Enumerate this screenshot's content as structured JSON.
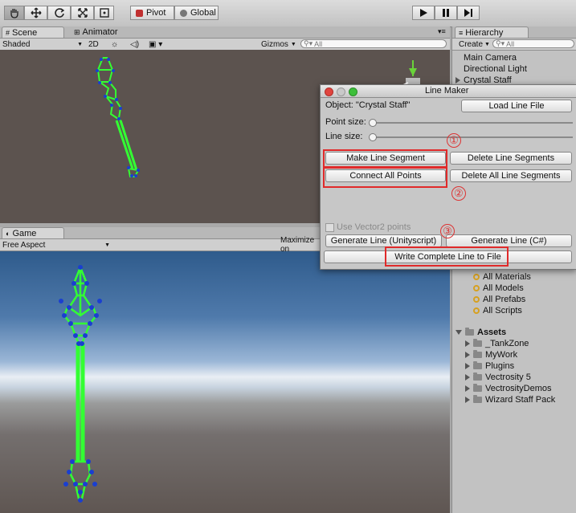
{
  "toolbar": {
    "tools": [
      "hand-icon",
      "move-icon",
      "rotate-icon",
      "scale-icon",
      "rect-icon"
    ],
    "pivot_label": "Pivot",
    "global_label": "Global"
  },
  "scene_panel": {
    "tab_scene": "Scene",
    "tab_animator": "Animator",
    "shading_mode": "Shaded",
    "mode_2d": "2D",
    "gizmos_label": "Gizmos",
    "search_placeholder": "All"
  },
  "game_panel": {
    "tab_game": "Game",
    "aspect": "Free Aspect",
    "maximize_label": "Maximize on"
  },
  "hierarchy": {
    "tab_label": "Hierarchy",
    "create_label": "Create",
    "search_placeholder": "All",
    "items": [
      "Main Camera",
      "Directional Light",
      "Crystal Staff"
    ]
  },
  "project": {
    "favorites": [
      "All Materials",
      "All Models",
      "All Prefabs",
      "All Scripts"
    ],
    "assets_label": "Assets",
    "folders": [
      "_TankZone",
      "MyWork",
      "Plugins",
      "Vectrosity 5",
      "VectrosityDemos",
      "Wizard Staff Pack"
    ]
  },
  "line_maker": {
    "title": "Line Maker",
    "object_label": "Object: \"Crystal Staff\"",
    "load_button": "Load Line File",
    "point_size_label": "Point size:",
    "point_size_value": 0,
    "line_size_label": "Line size:",
    "line_size_value": 0,
    "make_segment_button": "Make Line Segment",
    "delete_segments_button": "Delete Line Segments",
    "connect_points_button": "Connect All Points",
    "delete_all_segments_button": "Delete All Line Segments",
    "use_vector2_label": "Use Vector2 points",
    "generate_unityscript_button": "Generate Line (Unityscript)",
    "generate_csharp_button": "Generate Line (C#)",
    "write_file_button": "Write Complete Line to File",
    "markers": [
      "①",
      "②",
      "③"
    ]
  },
  "colors": {
    "highlight_red": "#e02a2a",
    "line_green": "#33ff33",
    "point_blue": "#1a3fd0"
  }
}
